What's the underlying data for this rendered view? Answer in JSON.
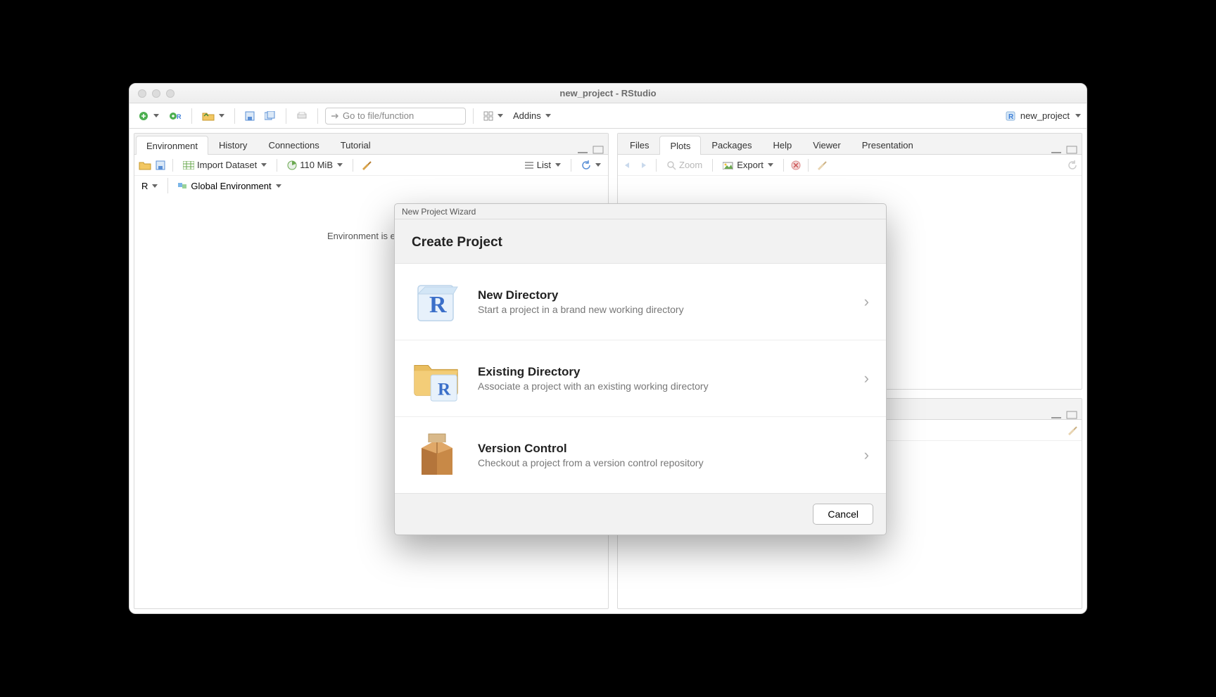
{
  "window": {
    "title": "new_project - RStudio",
    "project_label": "new_project"
  },
  "main_toolbar": {
    "goto_placeholder": "Go to file/function",
    "addins_label": "Addins"
  },
  "left": {
    "tabs": [
      "Environment",
      "History",
      "Connections",
      "Tutorial"
    ],
    "active_tab": 0,
    "import_label": "Import Dataset",
    "memory_label": "110 MiB",
    "view_label": "List",
    "scope_r": "R",
    "scope_env": "Global Environment",
    "empty_text": "Environment is empty"
  },
  "right_top": {
    "tabs": [
      "Files",
      "Plots",
      "Packages",
      "Help",
      "Viewer",
      "Presentation"
    ],
    "active_tab": 1,
    "zoom_label": "Zoom",
    "export_label": "Export"
  },
  "modal": {
    "title": "New Project Wizard",
    "header": "Create Project",
    "options": [
      {
        "title": "New Directory",
        "desc": "Start a project in a brand new working directory"
      },
      {
        "title": "Existing Directory",
        "desc": "Associate a project with an existing working directory"
      },
      {
        "title": "Version Control",
        "desc": "Checkout a project from a version control repository"
      }
    ],
    "cancel_label": "Cancel"
  }
}
